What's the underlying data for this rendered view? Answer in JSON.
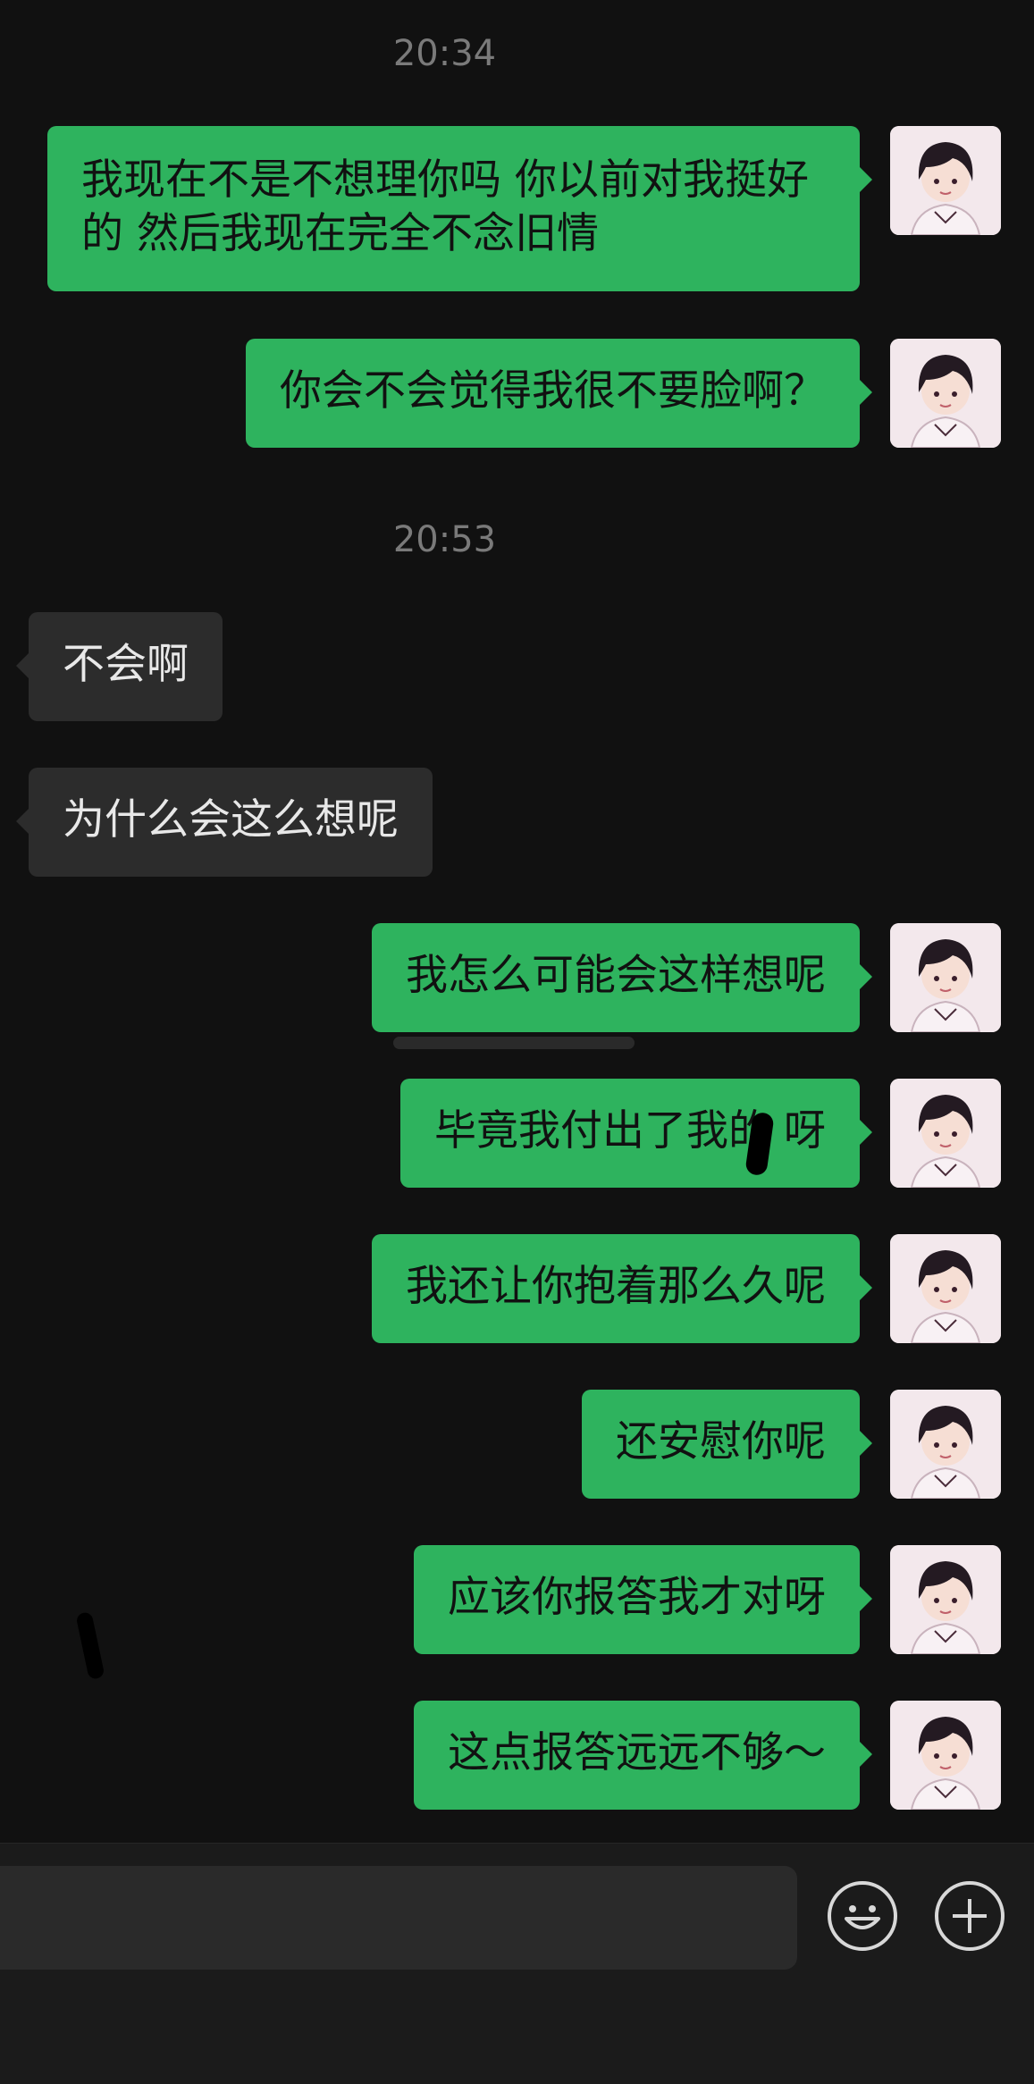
{
  "timestamps": [
    "20:34",
    "20:53"
  ],
  "messages": [
    {
      "side": "sent",
      "text": "我现在不是不想理你吗  你以前对我挺好的 然后我现在完全不念旧情"
    },
    {
      "side": "sent",
      "text": "你会不会觉得我很不要脸啊？"
    },
    {
      "side": "received",
      "text": "不会啊"
    },
    {
      "side": "received",
      "text": "为什么会这么想呢"
    },
    {
      "side": "sent",
      "text": "我怎么可能会这样想呢"
    },
    {
      "side": "sent",
      "text": "毕竟我付出了我的    呀"
    },
    {
      "side": "sent",
      "text": "我还让你抱着那么久呢"
    },
    {
      "side": "sent",
      "text": "还安慰你呢"
    },
    {
      "side": "sent",
      "text": "应该你报答我才对呀"
    },
    {
      "side": "sent",
      "text": "这点报答远远不够～"
    }
  ],
  "input_bar": {
    "message_input_value": "",
    "emoji_icon": "smiley-face-icon",
    "plus_icon": "plus-circle-icon"
  },
  "colors": {
    "background": "#111111",
    "sent_bubble": "#2eb35e",
    "received_bubble": "#2c2c2c",
    "timestamp_text": "#7a7a7a"
  }
}
